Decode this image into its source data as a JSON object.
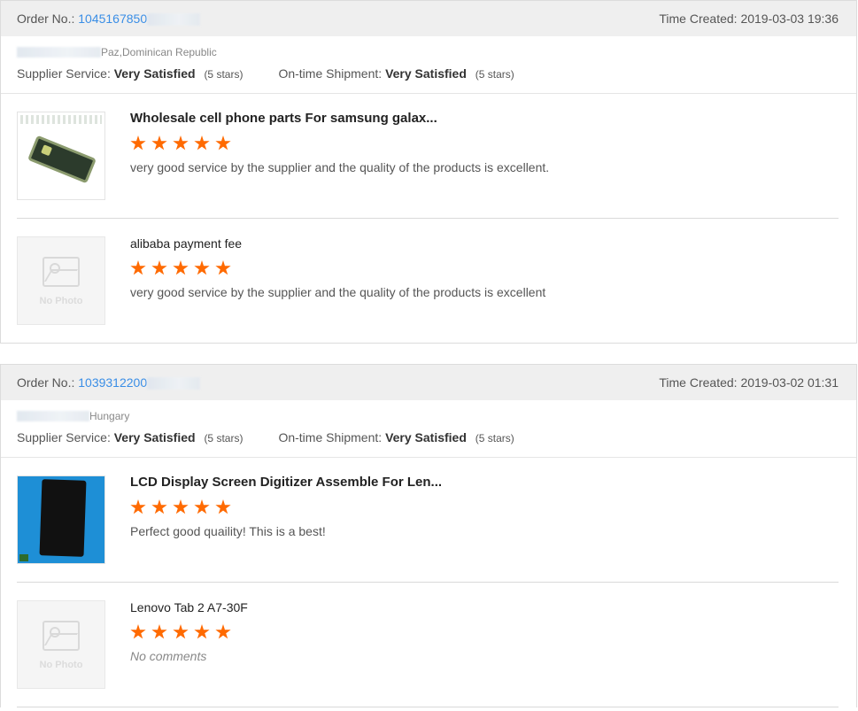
{
  "orders": [
    {
      "order_label": "Order No.:",
      "order_no": "1045167850",
      "time_label": "Time Created:",
      "time": "2019-03-03 19:36",
      "location": "Paz,Dominican Republic",
      "supplier_label": "Supplier Service:",
      "supplier_value": "Very Satisfied",
      "supplier_stars": "(5 stars)",
      "shipment_label": "On-time Shipment:",
      "shipment_value": "Very Satisfied",
      "shipment_stars": "(5 stars)",
      "products": [
        {
          "title": "Wholesale cell phone parts For samsung galax...",
          "rating": 5,
          "comment": "very good service by the supplier and the quality of the products is excellent.",
          "thumb": "phone-part-image"
        },
        {
          "title": "alibaba payment fee",
          "rating": 5,
          "comment": "very good service by the supplier and the quality of the products is excellent",
          "thumb": "no-photo",
          "no_photo_text": "No Photo"
        }
      ]
    },
    {
      "order_label": "Order No.:",
      "order_no": "1039312200",
      "time_label": "Time Created:",
      "time": "2019-03-02 01:31",
      "location": "Hungary",
      "supplier_label": "Supplier Service:",
      "supplier_value": "Very Satisfied",
      "supplier_stars": "(5 stars)",
      "shipment_label": "On-time Shipment:",
      "shipment_value": "Very Satisfied",
      "shipment_stars": "(5 stars)",
      "products": [
        {
          "title": "LCD Display Screen Digitizer Assemble For Len...",
          "rating": 5,
          "comment": "Perfect good quaility! This is a best!",
          "thumb": "lcd-image"
        },
        {
          "title": "Lenovo Tab 2 A7-30F",
          "rating": 5,
          "comment": "No comments",
          "thumb": "no-photo",
          "no_photo_text": "No Photo"
        }
      ]
    }
  ],
  "colors": {
    "star": "#ff6a00",
    "link": "#3a8ee6",
    "header_bg": "#efefef"
  }
}
